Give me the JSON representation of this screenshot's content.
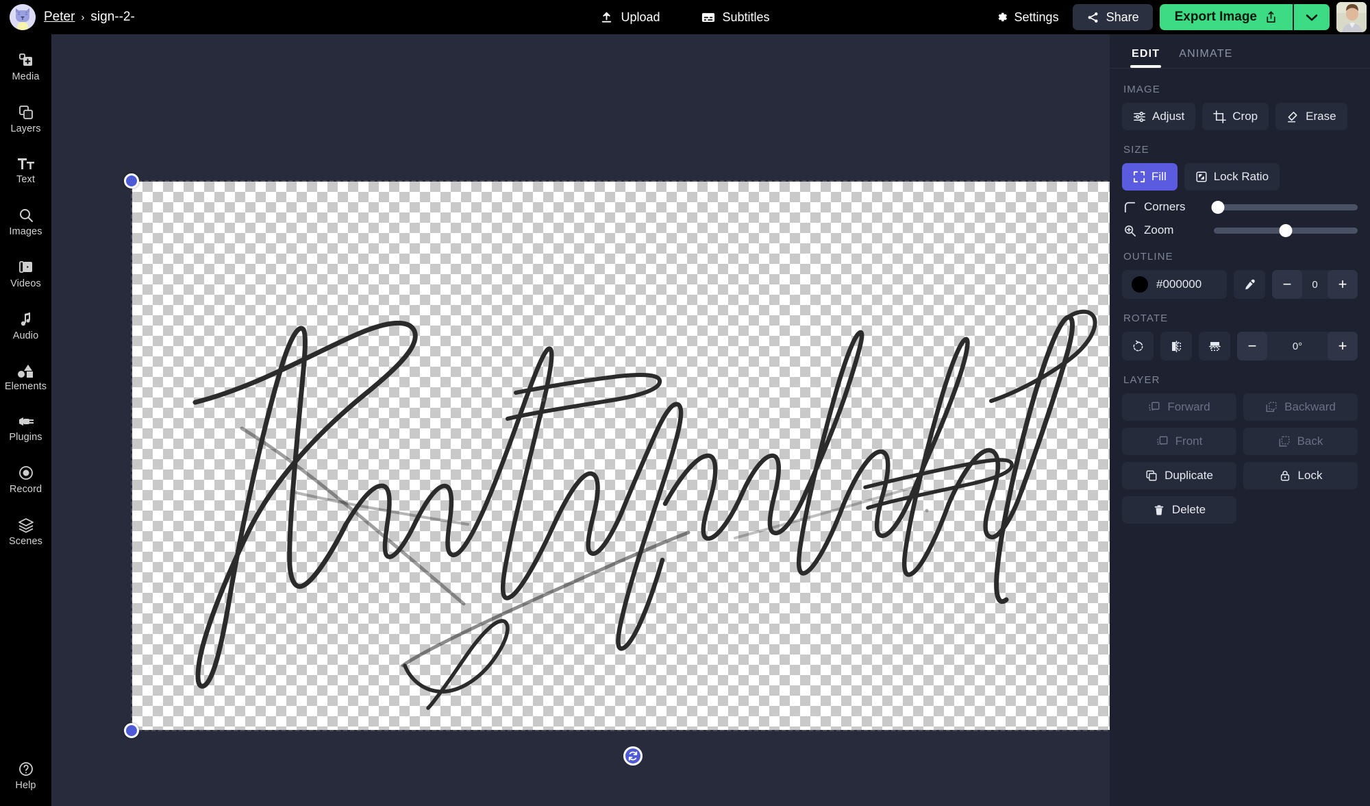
{
  "header": {
    "breadcrumb": {
      "workspace": "Peter",
      "separator": "›",
      "project": "sign--2-"
    },
    "avatar_name": "cat-avatar",
    "center_buttons": [
      {
        "label": "Upload",
        "icon": "upload-icon"
      },
      {
        "label": "Subtitles",
        "icon": "subtitles-icon"
      }
    ],
    "settings_label": "Settings",
    "share_label": "Share",
    "export_label": "Export Image",
    "export_caret_icon": "chevron-down-icon",
    "user_avatar": "user-profile-photo"
  },
  "sidebar": {
    "items": [
      {
        "label": "Media",
        "icon": "media-plus-icon"
      },
      {
        "label": "Layers",
        "icon": "layers-copy-icon"
      },
      {
        "label": "Text",
        "icon": "text-tt-icon"
      },
      {
        "label": "Images",
        "icon": "search-icon"
      },
      {
        "label": "Videos",
        "icon": "video-icon"
      },
      {
        "label": "Audio",
        "icon": "music-note-icon"
      },
      {
        "label": "Elements",
        "icon": "shapes-icon"
      },
      {
        "label": "Plugins",
        "icon": "plug-icon"
      },
      {
        "label": "Record",
        "icon": "record-dot-icon"
      },
      {
        "label": "Scenes",
        "icon": "scenes-stack-icon"
      }
    ],
    "help": {
      "label": "Help",
      "icon": "question-circle-icon"
    }
  },
  "canvas": {
    "object_type": "image",
    "object_name": "signature-image",
    "background": "transparent-checkerboard",
    "selected": true,
    "handles": [
      "top-left",
      "top-right",
      "bottom-left",
      "bottom-right"
    ],
    "rotate_handle_icon": "rotate-icon"
  },
  "panel": {
    "tabs": [
      {
        "label": "EDIT",
        "active": true
      },
      {
        "label": "ANIMATE",
        "active": false
      }
    ],
    "image": {
      "title": "IMAGE",
      "buttons": [
        {
          "label": "Adjust",
          "icon": "sliders-icon"
        },
        {
          "label": "Crop",
          "icon": "crop-icon"
        },
        {
          "label": "Erase",
          "icon": "eraser-icon"
        }
      ]
    },
    "size": {
      "title": "SIZE",
      "fill_label": "Fill",
      "fill_active": true,
      "lock_ratio_label": "Lock Ratio",
      "corners_label": "Corners",
      "corners_value": 0,
      "zoom_label": "Zoom",
      "zoom_value": 50
    },
    "outline": {
      "title": "OUTLINE",
      "color_hex": "#000000",
      "eyedropper_icon": "eyedropper-icon",
      "width_value": "0",
      "minus_label": "−",
      "plus_label": "+"
    },
    "rotate": {
      "title": "ROTATE",
      "rotate_icon": "rotate-cw-icon",
      "flip_h_icon": "flip-horizontal-icon",
      "flip_v_icon": "flip-vertical-icon",
      "angle_value": "0°",
      "minus_label": "−",
      "plus_label": "+"
    },
    "layer": {
      "title": "LAYER",
      "buttons": [
        {
          "label": "Forward",
          "icon": "bring-forward-icon",
          "enabled": false
        },
        {
          "label": "Backward",
          "icon": "send-backward-icon",
          "enabled": false
        },
        {
          "label": "Front",
          "icon": "bring-front-icon",
          "enabled": false
        },
        {
          "label": "Back",
          "icon": "send-back-icon",
          "enabled": false
        },
        {
          "label": "Duplicate",
          "icon": "duplicate-icon",
          "enabled": true
        },
        {
          "label": "Lock",
          "icon": "lock-icon",
          "enabled": true
        },
        {
          "label": "Delete",
          "icon": "trash-icon",
          "enabled": true
        }
      ]
    }
  },
  "colors": {
    "accent_green": "#3ddc84",
    "accent_indigo": "#5b5be0",
    "handle_blue": "#4f5bd5",
    "panel_bg": "#1d2130",
    "stage_bg": "#272b3b",
    "rail_bg": "#000000"
  }
}
